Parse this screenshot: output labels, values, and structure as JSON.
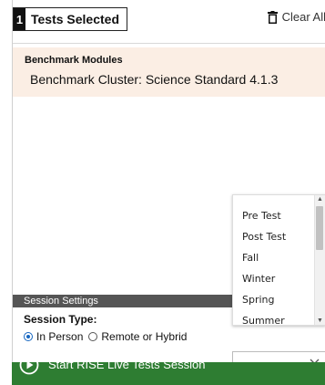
{
  "header": {
    "selected_count": "1",
    "selected_label": "Tests Selected",
    "clear_all_label": "Clear All"
  },
  "module": {
    "type_label": "Benchmark Modules",
    "name": "Benchmark Cluster: Science Standard 4.1.3"
  },
  "session": {
    "header_label": "Session Settings",
    "type_label": "Session Type:",
    "options": [
      {
        "label": "In Person",
        "checked": true
      },
      {
        "label": "Remote or Hybrid",
        "checked": false
      }
    ]
  },
  "dropdown": {
    "options": [
      "Pre Test",
      "Post Test",
      "Fall",
      "Winter",
      "Spring",
      "Summer"
    ]
  },
  "start": {
    "label": "Start RISE Live Tests Session",
    "color": "#2e7d32"
  }
}
